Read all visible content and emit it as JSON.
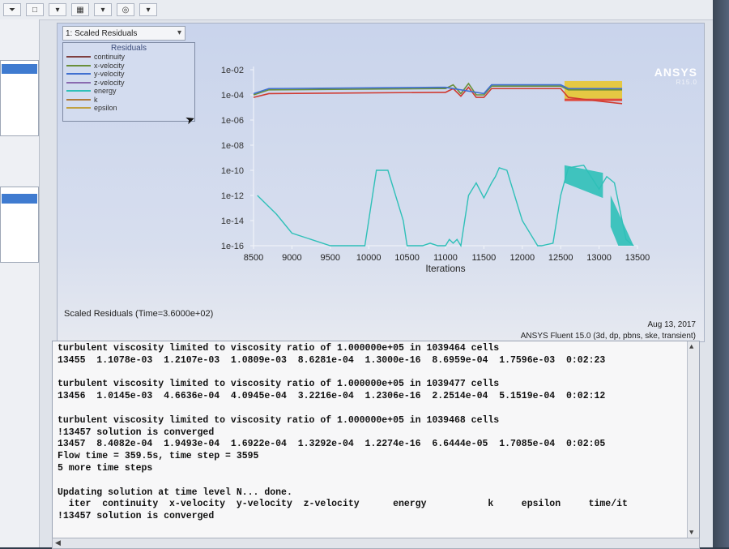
{
  "toolbar": {
    "items": [
      "⏷",
      "□",
      "▾",
      "▦",
      "▾",
      "◎",
      "▾"
    ]
  },
  "graphics": {
    "dropdown_label": "1: Scaled Residuals",
    "legend": {
      "title": "Residuals",
      "entries": [
        {
          "label": "continuity",
          "color": "#7f3f3f"
        },
        {
          "label": "x-velocity",
          "color": "#6a8f3a"
        },
        {
          "label": "y-velocity",
          "color": "#3f6fd0"
        },
        {
          "label": "z-velocity",
          "color": "#8a6ab0"
        },
        {
          "label": "energy",
          "color": "#2fc0b8"
        },
        {
          "label": "k",
          "color": "#b07a3a"
        },
        {
          "label": "epsilon",
          "color": "#c0a040"
        }
      ]
    },
    "brand": "ANSYS",
    "brand_sub": "R15.0",
    "caption_left": "Scaled Residuals  (Time=3.6000e+02)",
    "caption_date": "Aug 13, 2017",
    "caption_product": "ANSYS Fluent 15.0 (3d, dp, pbns, ske, transient)"
  },
  "chart_data": {
    "type": "line",
    "title": "",
    "xlabel": "Iterations",
    "ylabel": "",
    "xlim": [
      8500,
      13500
    ],
    "ylim": [
      "1e-16",
      "1e-02"
    ],
    "y_scale": "log",
    "x_ticks": [
      "8500",
      "9000",
      "9500",
      "10000",
      "10500",
      "11000",
      "11500",
      "12000",
      "12500",
      "13000",
      "13500"
    ],
    "y_ticks": [
      "1e-02",
      "1e-04",
      "1e-06",
      "1e-08",
      "1e-10",
      "1e-12",
      "1e-14",
      "1e-16"
    ],
    "series": [
      {
        "name": "continuity",
        "color": "#d03a30",
        "x": [
          8500,
          8700,
          10900,
          11000,
          11100,
          11200,
          11300,
          11400,
          11500,
          11600,
          12500,
          12600,
          13000,
          13300
        ],
        "y": [
          -4.2,
          -3.9,
          -3.8,
          -3.8,
          -3.5,
          -4.1,
          -3.4,
          -4.2,
          -4.2,
          -3.5,
          -3.5,
          -4.2,
          -4.5,
          -4.7
        ]
      },
      {
        "name": "x-velocity",
        "color": "#6a8f3a",
        "x": [
          8500,
          8700,
          10900,
          11000,
          11100,
          11200,
          11300,
          11400,
          11500,
          11600,
          12500,
          12600,
          13300
        ],
        "y": [
          -4.0,
          -3.6,
          -3.5,
          -3.5,
          -3.2,
          -3.9,
          -3.1,
          -4.0,
          -4.0,
          -3.3,
          -3.3,
          -3.6,
          -3.6
        ]
      },
      {
        "name": "y-velocity",
        "color": "#3f6fd0",
        "x": [
          8500,
          8700,
          10900,
          11000,
          11500,
          11600,
          12500,
          12600,
          13300
        ],
        "y": [
          -3.9,
          -3.5,
          -3.4,
          -3.4,
          -3.9,
          -3.2,
          -3.2,
          -3.5,
          -3.5
        ]
      },
      {
        "name": "energy",
        "color": "#2fc0b8",
        "x": [
          8550,
          8800,
          9000,
          9500,
          9950,
          10000,
          10050,
          10100,
          10250,
          10300,
          10450,
          10500,
          10700,
          10800,
          10900,
          11000,
          11050,
          11100,
          11150,
          11200,
          11250,
          11300,
          11400,
          11500,
          11600,
          11650,
          11700,
          11800,
          12000,
          12150,
          12200,
          12250,
          12400,
          12500,
          12600,
          12800,
          13000,
          13100,
          13200,
          13250,
          13300,
          13350,
          13450
        ],
        "y": [
          -12.0,
          -13.5,
          -15.0,
          -16.0,
          -16.0,
          -14.0,
          -12.0,
          -10.0,
          -10.0,
          -11.0,
          -14.0,
          -16.0,
          -16.0,
          -15.8,
          -16.0,
          -16.0,
          -15.5,
          -15.8,
          -15.5,
          -16.0,
          -14.0,
          -12.0,
          -11.0,
          -12.2,
          -11.0,
          -10.5,
          -9.8,
          -10.0,
          -14.0,
          -15.5,
          -16.0,
          -16.0,
          -15.8,
          -12.0,
          -9.8,
          -9.6,
          -11.5,
          -10.5,
          -11.0,
          -12.5,
          -14.0,
          -15.5,
          -16.0
        ]
      }
    ]
  },
  "console": {
    "lines": [
      "turbulent viscosity limited to viscosity ratio of 1.000000e+05 in 1039464 cells",
      "13455  1.1078e-03  1.2107e-03  1.0809e-03  8.6281e-04  1.3000e-16  8.6959e-04  1.7596e-03  0:02:23",
      "",
      "turbulent viscosity limited to viscosity ratio of 1.000000e+05 in 1039477 cells",
      "13456  1.0145e-03  4.6636e-04  4.0945e-04  3.2216e-04  1.2306e-16  2.2514e-04  5.1519e-04  0:02:12",
      "",
      "turbulent viscosity limited to viscosity ratio of 1.000000e+05 in 1039468 cells",
      "!13457 solution is converged",
      "13457  8.4082e-04  1.9493e-04  1.6922e-04  1.3292e-04  1.2274e-16  6.6444e-05  1.7085e-04  0:02:05",
      "Flow time = 359.5s, time step = 3595",
      "5 more time steps",
      "",
      "Updating solution at time level N... done.",
      "  iter  continuity  x-velocity  y-velocity  z-velocity      energy           k     epsilon     time/it",
      "!13457 solution is converged"
    ]
  }
}
